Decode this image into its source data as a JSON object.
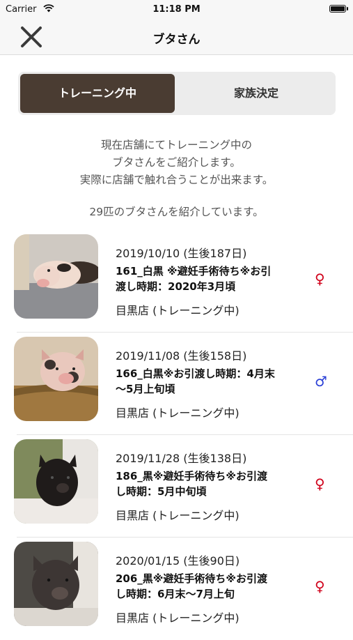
{
  "status_bar": {
    "carrier": "Carrier",
    "time": "11:18 PM"
  },
  "nav": {
    "title": "ブタさん",
    "close_icon": "close-icon"
  },
  "segments": [
    {
      "label": "トレーニング中",
      "selected": true
    },
    {
      "label": "家族決定",
      "selected": false
    }
  ],
  "intro": {
    "line1": "現在店舗にてトレーニング中の",
    "line2": "ブタさんをご紹介します。",
    "line3": "実際に店舗で触れ合うことが出来ます。"
  },
  "count_text": "29匹のブタさんを紹介しています。",
  "colors": {
    "accent": "#4a3c32",
    "female": "#d0021b",
    "male": "#2a3fd6"
  },
  "pigs": [
    {
      "date": "2019/10/10 (生後187日)",
      "name_line1": "161_白黒 ※避妊手術待ち※お引",
      "name_line2": "渡し時期：2020年3月頃",
      "store": "目黒店 (トレーニング中)",
      "sex_symbol": "♀",
      "sex": "female"
    },
    {
      "date": "2019/11/08 (生後158日)",
      "name_line1": "166_白黒※お引渡し時期：4月末",
      "name_line2": "〜5月上旬頃",
      "store": "目黒店 (トレーニング中)",
      "sex_symbol": "♂",
      "sex": "male"
    },
    {
      "date": "2019/11/28 (生後138日)",
      "name_line1": "186_黒※避妊手術待ち※お引渡",
      "name_line2": "し時期：5月中旬頃",
      "store": "目黒店 (トレーニング中)",
      "sex_symbol": "♀",
      "sex": "female"
    },
    {
      "date": "2020/01/15 (生後90日)",
      "name_line1": "206_黒※避妊手術待ち※お引渡",
      "name_line2": "し時期：6月末〜7月上旬",
      "store": "目黒店 (トレーニング中)",
      "sex_symbol": "♀",
      "sex": "female"
    }
  ]
}
